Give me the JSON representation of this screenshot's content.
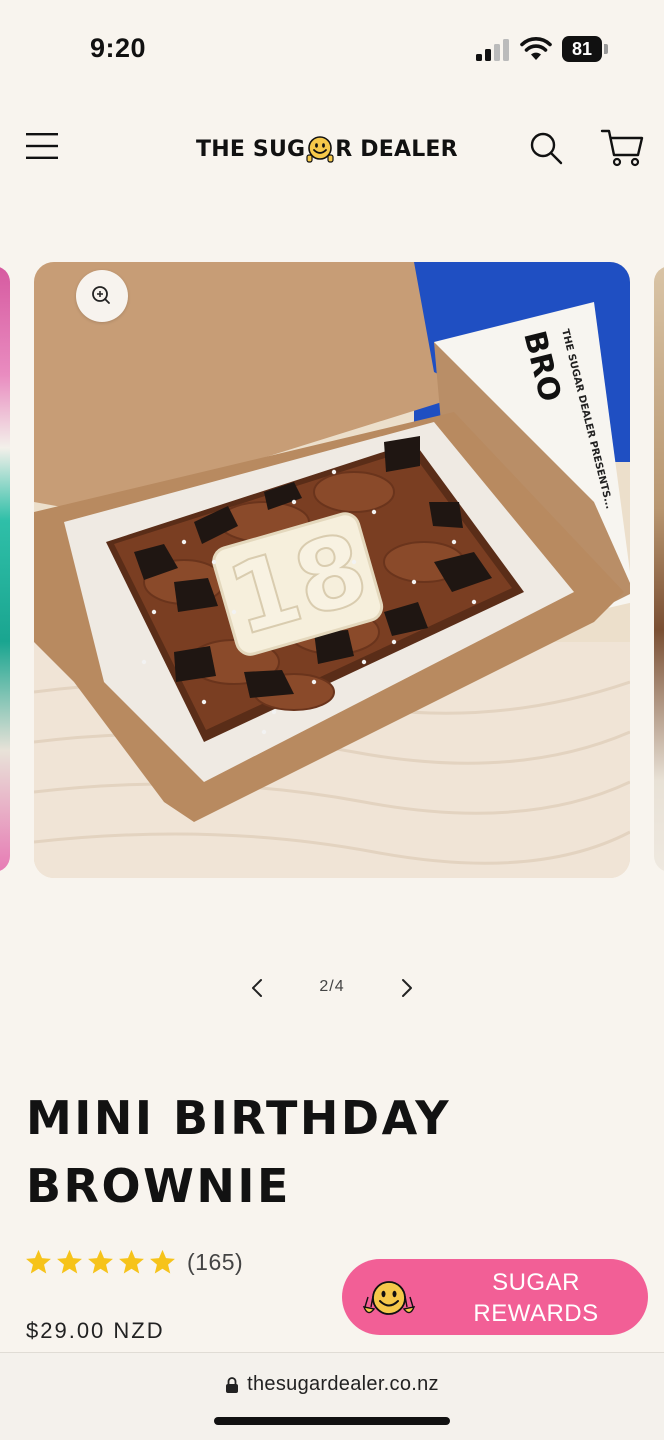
{
  "status_bar": {
    "time": "9:20",
    "battery": "81"
  },
  "header": {
    "logo_left": "THE SUG",
    "logo_right": "R DEALER",
    "icons": [
      "menu-icon",
      "search-icon",
      "cart-icon"
    ]
  },
  "gallery": {
    "counter": "2/4",
    "photo_number": "18",
    "box_text_small": "THE SUGAR DEALER PRESENTS...",
    "box_text_big": "BRO"
  },
  "product": {
    "title": "MINI BIRTHDAY BROWNIE",
    "rating": 5,
    "review_count": "(165)",
    "price": "$29.00 NZD"
  },
  "rewards": {
    "line1": "SUGAR",
    "line2": "REWARDS"
  },
  "browser": {
    "url": "thesugardealer.co.nz"
  },
  "colors": {
    "background": "#f8f4ee",
    "rewards_pink": "#f25f96",
    "star_yellow": "#f6c31a",
    "smiley_yellow": "#f5c84a"
  }
}
